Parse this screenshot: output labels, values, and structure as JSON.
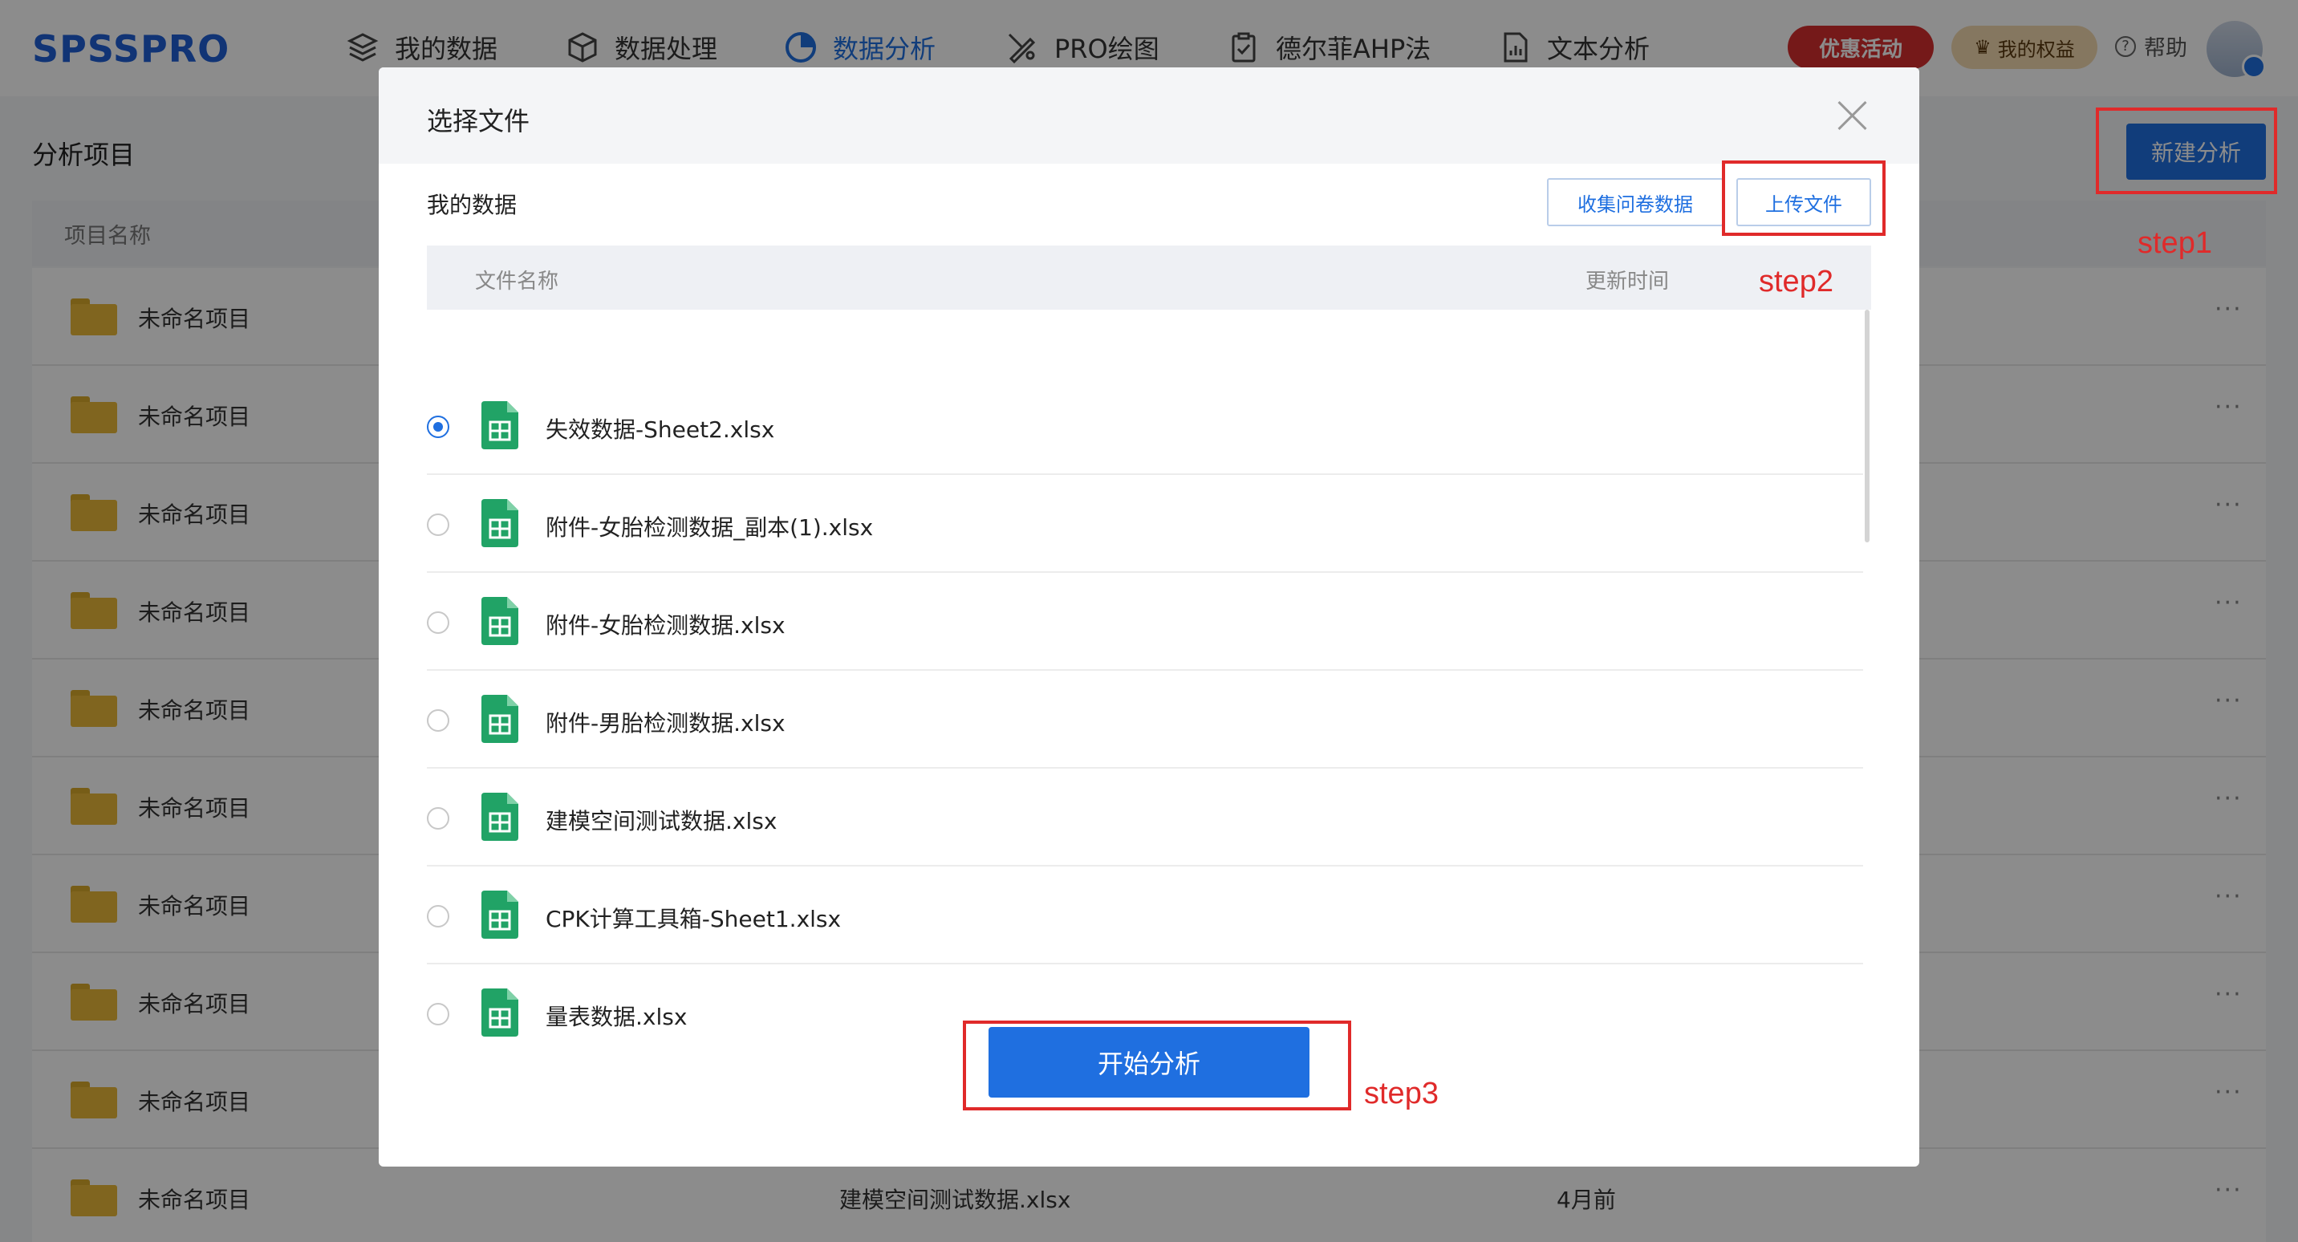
{
  "app": {
    "logo": "SPSSPRO",
    "nav": [
      {
        "label": "我的数据",
        "icon": "layers-icon"
      },
      {
        "label": "数据处理",
        "icon": "cube-icon"
      },
      {
        "label": "数据分析",
        "icon": "pie-chart-icon",
        "active": true
      },
      {
        "label": "PRO绘图",
        "icon": "drawing-tools-icon"
      },
      {
        "label": "德尔菲AHP法",
        "icon": "clipboard-check-icon"
      },
      {
        "label": "文本分析",
        "icon": "document-chart-icon"
      }
    ],
    "promo_label": "优惠活动",
    "rights_label": "我的权益",
    "help_label": "帮助",
    "accent": "#1f6fe0",
    "promo_color": "#d62e2e"
  },
  "projects": {
    "title": "分析项目",
    "new_button": "新建分析",
    "column_name": "项目名称",
    "rows": [
      {
        "name": "未命名项目"
      },
      {
        "name": "未命名项目"
      },
      {
        "name": "未命名项目"
      },
      {
        "name": "未命名项目"
      },
      {
        "name": "未命名项目"
      },
      {
        "name": "未命名项目"
      },
      {
        "name": "未命名项目"
      },
      {
        "name": "未命名项目"
      },
      {
        "name": "未命名项目"
      },
      {
        "name": "未命名项目",
        "file": "建模空间测试数据.xlsx",
        "time": "4月前"
      }
    ],
    "more_label": "···"
  },
  "modal": {
    "title": "选择文件",
    "section_label": "我的数据",
    "collect_button": "收集问卷数据",
    "upload_button": "上传文件",
    "col_file": "文件名称",
    "col_time": "更新时间",
    "files": [
      {
        "name": "失效数据-Sheet2.xlsx",
        "selected": true
      },
      {
        "name": "附件-女胎检测数据_副本(1).xlsx",
        "selected": false
      },
      {
        "name": "附件-女胎检测数据.xlsx",
        "selected": false
      },
      {
        "name": "附件-男胎检测数据.xlsx",
        "selected": false
      },
      {
        "name": "建模空间测试数据.xlsx",
        "selected": false
      },
      {
        "name": "CPK计算工具箱-Sheet1.xlsx",
        "selected": false
      },
      {
        "name": "量表数据.xlsx",
        "selected": false
      }
    ],
    "start_button": "开始分析"
  },
  "annotations": {
    "step1": "step1",
    "step2": "step2",
    "step3": "step3",
    "color": "#e02a2a"
  }
}
